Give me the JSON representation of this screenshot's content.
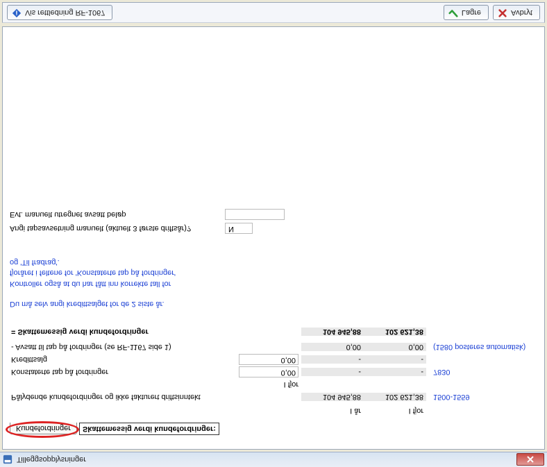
{
  "window": {
    "title": "Tilleggsopplysninger"
  },
  "tab": {
    "label": "Kundefordringer"
  },
  "section": {
    "title": "Skattemessig verdi kundefordringer:"
  },
  "headers": {
    "iaar": "I år",
    "ifjor": "I fjor"
  },
  "rows": {
    "palydende": {
      "label": "Pålydende kundefordringer og ikke fakturert driftsinntekt",
      "iaar": "104 945,88",
      "ifjor": "102 621,38",
      "note": "1500-1559"
    },
    "konstaterte": {
      "label": "Konstaterte tap på fordringer",
      "ifjor_in": "0,00",
      "iaar": "-",
      "ifjor": "-",
      "note": "7830"
    },
    "kredittsalg": {
      "label": "Kredittsalg",
      "ifjor_in": "0,00",
      "iaar": "-",
      "ifjor": "-"
    },
    "avsatt": {
      "label": "-  Avsatt til tap på fordringer (se RF-1167 side 1)",
      "iaar": "0,00",
      "ifjor": "0,00",
      "note": "(1580 posteres automatisk)"
    },
    "sum": {
      "label": "= Skattemessig verdi kundefordringer",
      "iaar": "104 945,88",
      "ifjor": "102 621,38"
    }
  },
  "notes": {
    "line1": "Du må selv angi kredittsalget for de 2 siste år.",
    "line2a": "Kontroller også at du har fått inn korrekte tall for",
    "line2b": "fjoråret i feltene for 'Konstaterte tap på fordringer'",
    "line2c": "og 'Til fradrag'."
  },
  "manual": {
    "q1": "Angi tapsavsetning manuelt (aktuelt 3 første driftsår)?",
    "q1_val": "N",
    "q2": "Evt. manuelt utregnet avsatt beløp"
  },
  "footer": {
    "guide": "Vis rettledning RF-1067",
    "save": "Lagre",
    "cancel": "Avbryt"
  }
}
